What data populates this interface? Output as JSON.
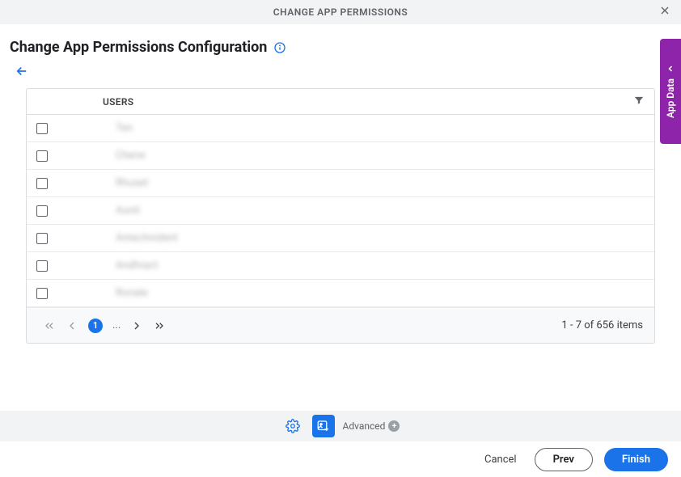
{
  "header": {
    "title": "CHANGE APP PERMISSIONS"
  },
  "page": {
    "title": "Change App Permissions Configuration"
  },
  "table": {
    "column_header": "USERS",
    "rows": [
      {
        "name": "Ten"
      },
      {
        "name": "Chene"
      },
      {
        "name": "Rhuset"
      },
      {
        "name": "Aunti"
      },
      {
        "name": "Antechnident"
      },
      {
        "name": "Andhract"
      },
      {
        "name": "Ronale"
      }
    ]
  },
  "pager": {
    "current_page": "1",
    "ellipsis": "...",
    "info": "1 - 7 of 656 items"
  },
  "side_tab": {
    "label": "App Data"
  },
  "toolbar": {
    "advanced": "Advanced"
  },
  "footer": {
    "cancel": "Cancel",
    "prev": "Prev",
    "finish": "Finish"
  }
}
